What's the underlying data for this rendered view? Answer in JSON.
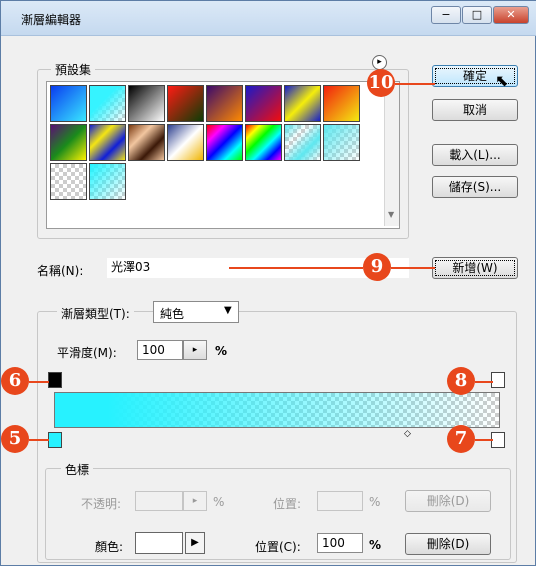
{
  "window": {
    "title": "漸層編輯器"
  },
  "caption_buttons": {
    "minimize": "−",
    "maximize": "□",
    "close": "✕"
  },
  "presets": {
    "legend": "預設集",
    "swatches": [
      {
        "bg": "linear-gradient(135deg,#0a3cf0,#39e7ff)"
      },
      {
        "bg": "linear-gradient(135deg,#36f3ff,#36f3ff 40%,transparent)",
        "checker": true
      },
      {
        "bg": "linear-gradient(135deg,#000,#fff)"
      },
      {
        "bg": "linear-gradient(135deg,#ff1b14,#0b3d06)"
      },
      {
        "bg": "linear-gradient(135deg,#3b0a6b,#ff8a00)"
      },
      {
        "bg": "linear-gradient(135deg,#1a19c8,#f20d0d)"
      },
      {
        "bg": "linear-gradient(135deg,#141dcb,#f5ee0b,#141dcb)"
      },
      {
        "bg": "linear-gradient(135deg,#f21f0e,#f3ea12)"
      },
      {
        "bg": "linear-gradient(135deg,#5b0f74,#1a8b1b,#fff200)"
      },
      {
        "bg": "linear-gradient(135deg,#101ed9,#f4e612,#101ed9,#f4e612)"
      },
      {
        "bg": "linear-gradient(135deg,#7a3a12,#f2c6a0,#3b1807,#f2c6a0)"
      },
      {
        "bg": "linear-gradient(135deg,#2d3f8f,#ffffff,#f0b400)"
      },
      {
        "bg": "linear-gradient(135deg,#ff0000,#ff00ff,#0000ff,#00ffff,#00ff00)"
      },
      {
        "bg": "linear-gradient(135deg,#ff0000,#ffff00,#00ff00,#00ffff,#0000ff,#ff00ff)",
        "checker": true
      },
      {
        "bg": "linear-gradient(135deg,#5fe8f0,transparent,#5fe8f0,transparent)",
        "checker": true
      },
      {
        "bg": "linear-gradient(135deg,#5fe8f0,transparent)",
        "checker": true
      },
      {
        "bg": "linear-gradient(135deg,transparent,transparent)",
        "checker": true
      },
      {
        "bg": "linear-gradient(135deg,#21f4ff,transparent)",
        "checker": true
      }
    ]
  },
  "buttons": {
    "ok": "確定",
    "cancel": "取消",
    "load": "載入(L)...",
    "save": "儲存(S)...",
    "new": "新增(W)"
  },
  "name": {
    "label": "名稱(N):",
    "value": "光澤03"
  },
  "gradient": {
    "type_label": "漸層類型(T):",
    "type_value": "純色",
    "smooth_label": "平滑度(M):",
    "smooth_value": "100",
    "smooth_unit": "%"
  },
  "stops": {
    "legend": "色標",
    "opacity_label": "不透明:",
    "opacity_unit": "%",
    "location_label_1": "位置:",
    "location_unit_1": "%",
    "delete_1": "刪除(D)",
    "color_label": "顏色:",
    "location_label_2": "位置(C):",
    "location_value_2": "100",
    "location_unit_2": "%",
    "delete_2": "刪除(D)"
  },
  "callouts": {
    "c5": "5",
    "c6": "6",
    "c7": "7",
    "c8": "8",
    "c9": "9",
    "c10": "10"
  },
  "colors": {
    "accent": "#e8471c",
    "gradient_color": "#27f2ff"
  }
}
